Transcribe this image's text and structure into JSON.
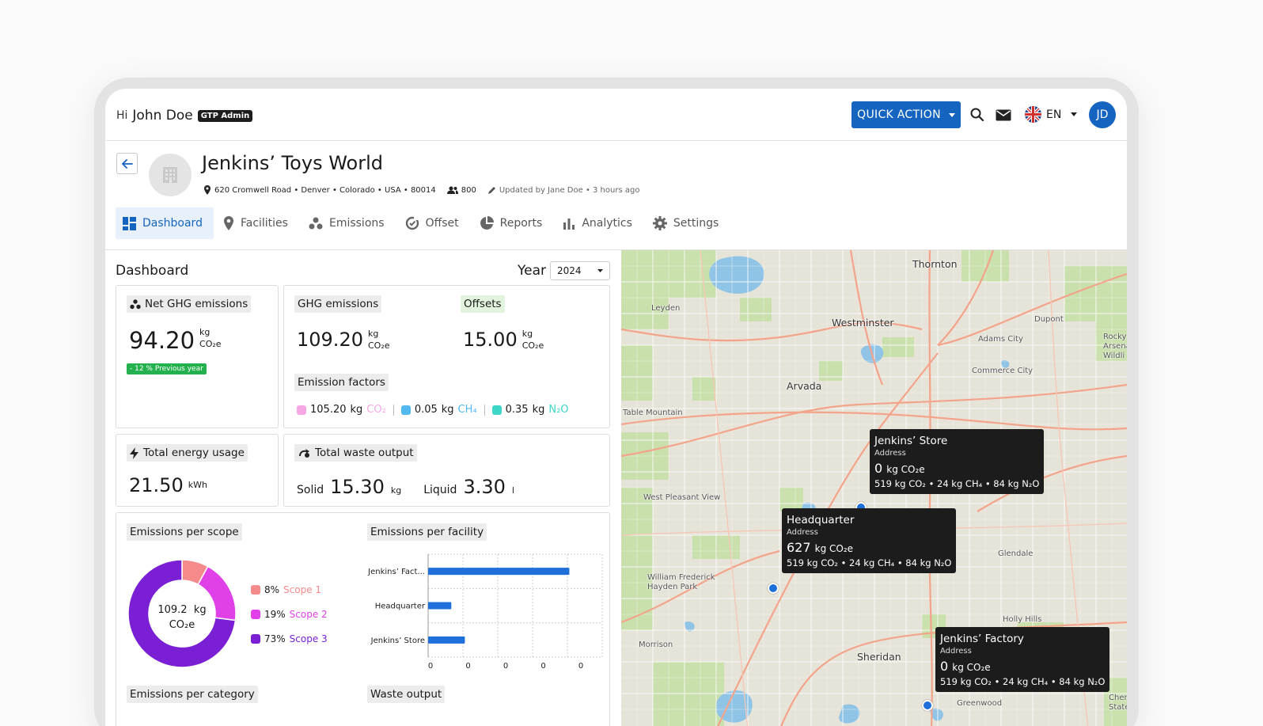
{
  "header": {
    "greeting": "Hi",
    "user_name": "John Doe",
    "role_badge": "GTP Admin",
    "quick_action_label": "QUICK ACTION",
    "language": "EN",
    "avatar_initials": "JD"
  },
  "org": {
    "name": "Jenkins’ Toys World",
    "address": "620 Cromwell Road • Denver • Colorado • USA • 80014",
    "employees": "800",
    "updated": "Updated by Jane Doe • 3 hours ago"
  },
  "tabs": [
    {
      "label": "Dashboard",
      "icon": "dashboard-icon",
      "active": true
    },
    {
      "label": "Facilities",
      "icon": "location-pin-icon"
    },
    {
      "label": "Emissions",
      "icon": "molecule-icon"
    },
    {
      "label": "Offset",
      "icon": "offset-icon"
    },
    {
      "label": "Reports",
      "icon": "pie-icon"
    },
    {
      "label": "Analytics",
      "icon": "bar-chart-icon"
    },
    {
      "label": "Settings",
      "icon": "gear-icon"
    }
  ],
  "dashboard": {
    "title": "Dashboard",
    "year_label": "Year",
    "year_value": "2024",
    "net_ghg": {
      "label": "Net GHG emissions",
      "value": "94.20",
      "unit_top": "kg",
      "unit_bottom": "CO₂e",
      "delta": "- 12 % Previous year"
    },
    "ghg": {
      "label": "GHG emissions",
      "value": "109.20",
      "unit_top": "kg",
      "unit_bottom": "CO₂e"
    },
    "offsets": {
      "label": "Offsets",
      "value": "15.00",
      "unit_top": "kg",
      "unit_bottom": "CO₂e"
    },
    "emission_factors": {
      "label": "Emission factors",
      "items": [
        {
          "value": "105.20",
          "unit": "kg",
          "gas": "CO₂",
          "color": "#f7a8e4"
        },
        {
          "value": "0.05",
          "unit": "kg",
          "gas": "CH₄",
          "color": "#52b8f0"
        },
        {
          "value": "0.35",
          "unit": "kg",
          "gas": "N₂O",
          "color": "#3dd7c8"
        }
      ]
    },
    "energy": {
      "label": "Total energy usage",
      "value": "21.50",
      "unit": "kWh"
    },
    "waste": {
      "label": "Total waste output",
      "solid_label": "Solid",
      "solid_value": "15.30",
      "solid_unit": "kg",
      "liquid_label": "Liquid",
      "liquid_value": "3.30",
      "liquid_unit": "l"
    },
    "scope_title": "Emissions per scope",
    "facility_title": "Emissions per facility",
    "category_title": "Emissions per category",
    "waste_title": "Waste output",
    "donut_center_value": "109.2",
    "donut_center_unit": "kg",
    "donut_center_unit2": "CO₂e"
  },
  "chart_data": [
    {
      "type": "pie",
      "title": "Emissions per scope",
      "categories": [
        "Scope 1",
        "Scope 2",
        "Scope 3"
      ],
      "values": [
        8,
        19,
        73
      ],
      "labels": [
        "8%",
        "19%",
        "73%"
      ],
      "colors": [
        "#f58a8a",
        "#e040e8",
        "#7a1fd4"
      ]
    },
    {
      "type": "bar",
      "orientation": "horizontal",
      "title": "Emissions per facility",
      "categories": [
        "Jenkins’ Fact...",
        "Headquarter",
        "Jenkins’ Store"
      ],
      "values": [
        0.73,
        0.12,
        0.19
      ],
      "x_tick_labels": [
        "0",
        "0",
        "0",
        "0",
        "0"
      ],
      "xlim": [
        0,
        0.9
      ],
      "color": "#1e6fd9",
      "grid": true
    }
  ],
  "map": {
    "places": [
      {
        "name": "Thornton",
        "cls": ""
      },
      {
        "name": "Westminster",
        "cls": ""
      },
      {
        "name": "Arvada",
        "cls": ""
      },
      {
        "name": "Adams City",
        "cls": "small"
      },
      {
        "name": "Commerce City",
        "cls": "small"
      },
      {
        "name": "Dupont",
        "cls": "small"
      },
      {
        "name": "Leyden",
        "cls": "small"
      },
      {
        "name": "Table Mountain",
        "cls": "small"
      },
      {
        "name": "West Pleasant View",
        "cls": "small"
      },
      {
        "name": "William Frederick Hayden Park",
        "cls": "small"
      },
      {
        "name": "Glendale",
        "cls": "small"
      },
      {
        "name": "Holly Hills",
        "cls": "small"
      },
      {
        "name": "Morrison",
        "cls": "small"
      },
      {
        "name": "Sheridan",
        "cls": ""
      },
      {
        "name": "Greenwood",
        "cls": "small"
      },
      {
        "name": "Rocky Arsena Wildli",
        "cls": "small"
      },
      {
        "name": "Cherry State",
        "cls": "small"
      }
    ],
    "facilities": [
      {
        "name": "Jenkins’ Store",
        "address": "Address",
        "value": "0",
        "unit": "kg CO₂e",
        "breakdown": "519 kg CO₂ • 24 kg CH₄ • 84 kg N₂O"
      },
      {
        "name": "Headquarter",
        "address": "Address",
        "value": "627",
        "unit": "kg CO₂e",
        "breakdown": "519 kg CO₂ • 24 kg CH₄ • 84 kg N₂O"
      },
      {
        "name": "Jenkins’ Factory",
        "address": "Address",
        "value": "0",
        "unit": "kg CO₂e",
        "breakdown": "519 kg CO₂ • 24 kg CH₄ • 84 kg N₂O"
      }
    ]
  }
}
